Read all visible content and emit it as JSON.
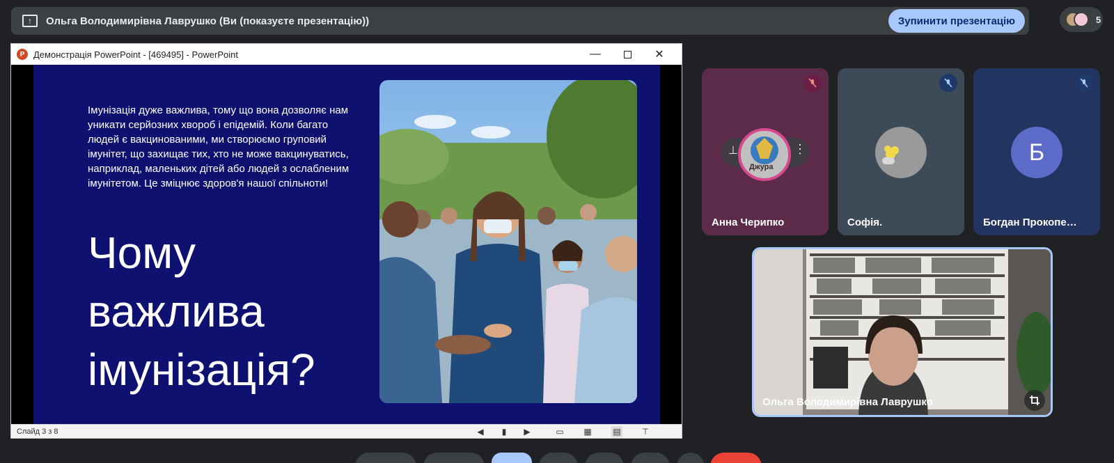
{
  "presenting_bar": {
    "title": "Ольга Володимирівна Лаврушко (Ви (показуєте презентацію))",
    "stop_button": "Зупинити презентацію",
    "participants_count": "5"
  },
  "ppt_window": {
    "title": "Демонстрація PowerPoint - [469495] - PowerPoint",
    "status_text": "Слайд 3 з 8"
  },
  "slide": {
    "paragraph": "Імунізація дуже важлива, тому що вона дозволяє нам уникати серйозних хвороб і епідемій. Коли багато людей є вакцинованими, ми створюємо груповий імунітет, що захищає тих, хто не може вакцинуватись, наприклад, маленьких дітей або людей з ослабленим імунітетом. Це зміцнює здоров'я нашої спільноти!",
    "heading_line1": "Чому",
    "heading_line2": "важлива",
    "heading_line3": "імунізація?"
  },
  "participants": [
    {
      "name": "Анна Черипко",
      "avatar_text": "Джура"
    },
    {
      "name": "Софія."
    },
    {
      "name": "Богдан Прокопе…",
      "initial": "Б"
    }
  ],
  "self_view": {
    "name": "Ольга Володимирівна Лаврушко"
  },
  "colors": {
    "background": "#202124",
    "bar": "#3c4043",
    "accent": "#a8c7fa",
    "slide_bg": "#0f1170",
    "leave_red": "#ea4335"
  }
}
